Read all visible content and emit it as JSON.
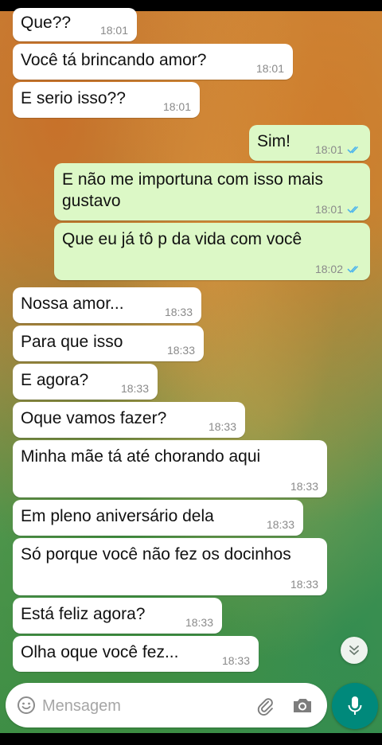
{
  "chat": {
    "messages": [
      {
        "text": "Que??",
        "time": "18:01",
        "dir": "in"
      },
      {
        "text": "Você tá brincando amor?",
        "time": "18:01",
        "dir": "in"
      },
      {
        "text": "E serio isso??",
        "time": "18:01",
        "dir": "in"
      },
      {
        "text": "Sim!",
        "time": "18:01",
        "dir": "out",
        "status": "read"
      },
      {
        "text": "E não me importuna com isso mais gustavo",
        "time": "18:01",
        "dir": "out",
        "status": "read"
      },
      {
        "text": "Que eu já tô p da vida com você",
        "time": "18:02",
        "dir": "out",
        "status": "read"
      },
      {
        "text": "Nossa amor...",
        "time": "18:33",
        "dir": "in"
      },
      {
        "text": "Para que isso",
        "time": "18:33",
        "dir": "in"
      },
      {
        "text": "E agora?",
        "time": "18:33",
        "dir": "in"
      },
      {
        "text": "Oque vamos fazer?",
        "time": "18:33",
        "dir": "in"
      },
      {
        "text": "Minha mãe tá até chorando aqui",
        "time": "18:33",
        "dir": "in"
      },
      {
        "text": "Em pleno aniversário dela",
        "time": "18:33",
        "dir": "in"
      },
      {
        "text": "Só porque você não fez os docinhos",
        "time": "18:33",
        "dir": "in"
      },
      {
        "text": "Está feliz agora?",
        "time": "18:33",
        "dir": "in"
      },
      {
        "text": "Olha oque você fez...",
        "time": "18:33",
        "dir": "in"
      }
    ]
  },
  "composer": {
    "placeholder": "Mensagem",
    "icons": [
      "emoji-icon",
      "paperclip-icon",
      "camera-icon",
      "microphone-icon"
    ]
  },
  "icons": {
    "scroll_down": "double-chevron-down-icon"
  },
  "colors": {
    "incoming_bubble": "#ffffff",
    "outgoing_bubble": "#dcf8c6",
    "read_ticks": "#4fb6ec",
    "mic_button": "#00897b"
  }
}
